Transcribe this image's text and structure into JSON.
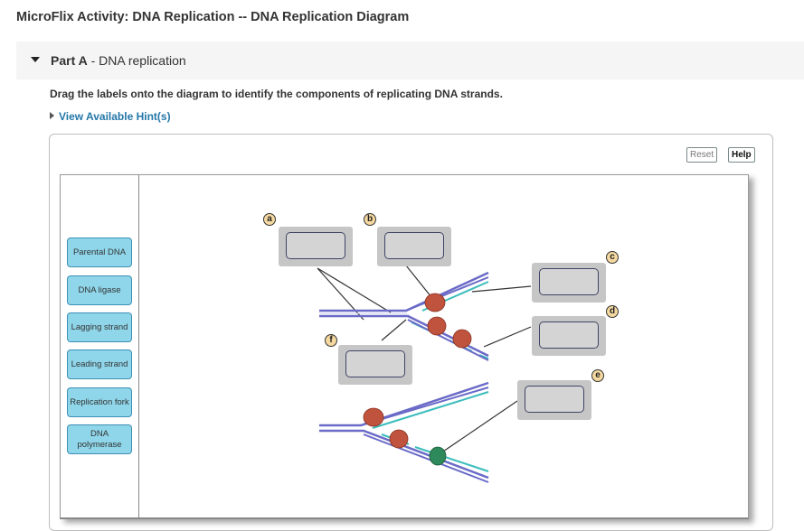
{
  "header": {
    "title": "MicroFlix Activity: DNA Replication -- DNA Replication Diagram"
  },
  "part": {
    "name": "Part A",
    "separator": " - ",
    "subtitle": "DNA replication"
  },
  "instructions": "Drag the labels onto the diagram to identify the components of replicating DNA strands.",
  "hint_link": "View Available Hint(s)",
  "toolbar": {
    "reset_label": "Reset",
    "help_label": "Help"
  },
  "labels": [
    {
      "text": "Parental DNA"
    },
    {
      "text": "DNA ligase"
    },
    {
      "text": "Lagging strand"
    },
    {
      "text": "Leading strand"
    },
    {
      "text": "Replication fork"
    },
    {
      "text": "DNA polymerase"
    }
  ],
  "targets": [
    {
      "letter": "a"
    },
    {
      "letter": "b"
    },
    {
      "letter": "c"
    },
    {
      "letter": "d"
    },
    {
      "letter": "e"
    },
    {
      "letter": "f"
    }
  ],
  "colors": {
    "label_fill": "#8fd6ea",
    "dna_strand": "#6a6ac8",
    "new_strand": "#3bbcbc",
    "polymerase": "#c0533d",
    "ligase": "#2e8a5a",
    "link": "#2477a8"
  }
}
